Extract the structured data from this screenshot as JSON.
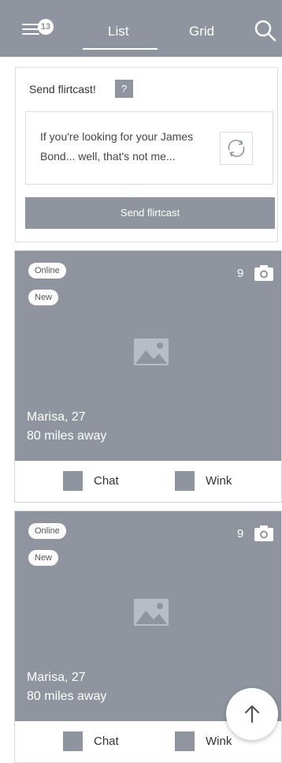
{
  "header": {
    "menu_badge": "13",
    "tabs": [
      {
        "label": "List",
        "active": true
      },
      {
        "label": "Grid",
        "active": false
      }
    ],
    "icons": {
      "menu": "hamburger-menu-icon",
      "search": "search-icon"
    }
  },
  "flirtcast": {
    "title": "Send flirtcast!",
    "help_label": "?",
    "message": "If you're looking for your James Bond... well, that's not me...",
    "send_label": "Send flirtcast",
    "icons": {
      "refresh": "refresh-icon"
    }
  },
  "profiles": [
    {
      "status": "Online",
      "badge": "New",
      "photo_count": "9",
      "name_age": "Marisa, 27",
      "distance": "80 miles away",
      "chat_label": "Chat",
      "wink_label": "Wink"
    },
    {
      "status": "Online",
      "badge": "New",
      "photo_count": "9",
      "name_age": "Marisa, 27",
      "distance": "80 miles away",
      "chat_label": "Chat",
      "wink_label": "Wink"
    }
  ],
  "colors": {
    "accent": "#8f949f",
    "background": "#ffffff"
  }
}
